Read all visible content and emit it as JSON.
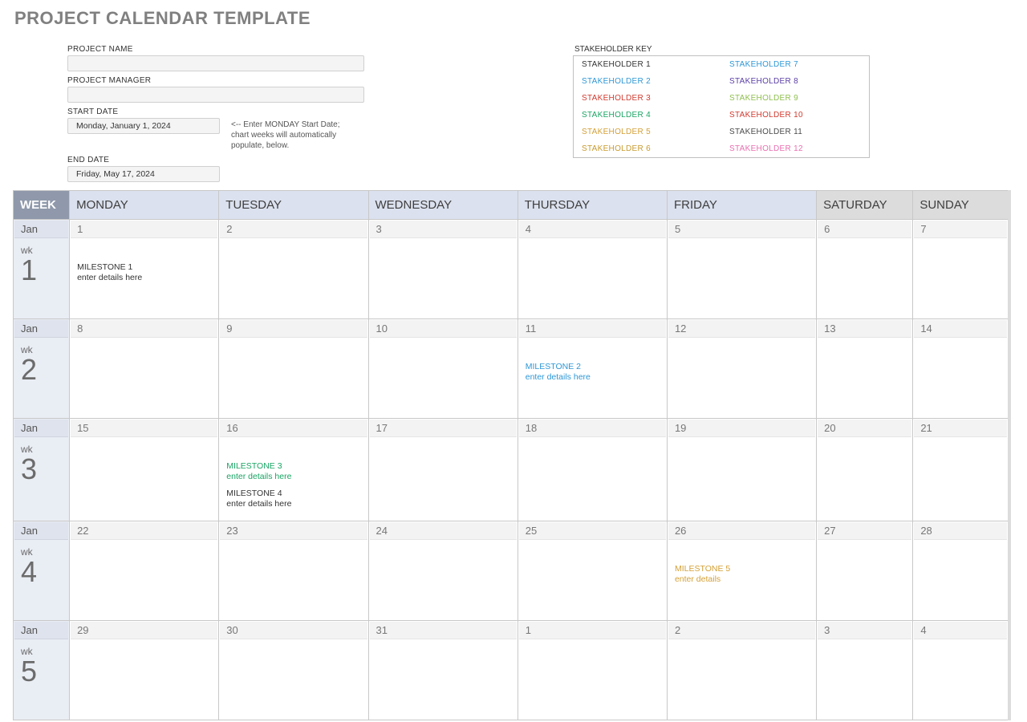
{
  "title": "PROJECT CALENDAR TEMPLATE",
  "labels": {
    "project_name": "PROJECT NAME",
    "project_manager": "PROJECT MANAGER",
    "start_date": "START DATE",
    "end_date": "END DATE",
    "stakeholder_key": "STAKEHOLDER KEY",
    "start_note": "<-- Enter MONDAY Start Date; chart weeks will automatically populate, below.",
    "week": "WEEK",
    "wk": "wk"
  },
  "fields": {
    "project_name": "",
    "project_manager": "",
    "start_date": "Monday, January 1, 2024",
    "end_date": "Friday, May 17, 2024"
  },
  "stakeholders": [
    {
      "label": "STAKEHOLDER 1",
      "color": "#333333"
    },
    {
      "label": "STAKEHOLDER 2",
      "color": "#2e97d6"
    },
    {
      "label": "STAKEHOLDER 3",
      "color": "#d13a2f"
    },
    {
      "label": "STAKEHOLDER 4",
      "color": "#1aa564"
    },
    {
      "label": "STAKEHOLDER 5",
      "color": "#d4a037"
    },
    {
      "label": "STAKEHOLDER 6",
      "color": "#c89b2e"
    },
    {
      "label": "STAKEHOLDER 7",
      "color": "#2e97d6"
    },
    {
      "label": "STAKEHOLDER 8",
      "color": "#5a3ea6"
    },
    {
      "label": "STAKEHOLDER 9",
      "color": "#8fbf4f"
    },
    {
      "label": "STAKEHOLDER 10",
      "color": "#d13a2f"
    },
    {
      "label": "STAKEHOLDER 11",
      "color": "#4a4a4a"
    },
    {
      "label": "STAKEHOLDER 12",
      "color": "#e86fb0"
    }
  ],
  "day_headers": [
    "MONDAY",
    "TUESDAY",
    "WEDNESDAY",
    "THURSDAY",
    "FRIDAY",
    "SATURDAY",
    "SUNDAY"
  ],
  "weeks": [
    {
      "month": "Jan",
      "num": "1",
      "days": [
        "1",
        "2",
        "3",
        "4",
        "5",
        "6",
        "7"
      ],
      "events": [
        [
          {
            "t1": "MILESTONE 1",
            "t2": "enter details here",
            "color": "#333333"
          }
        ],
        [],
        [],
        [],
        [],
        [],
        []
      ]
    },
    {
      "month": "Jan",
      "num": "2",
      "days": [
        "8",
        "9",
        "10",
        "11",
        "12",
        "13",
        "14"
      ],
      "events": [
        [],
        [],
        [],
        [
          {
            "t1": "MILESTONE 2",
            "t2": "enter details here",
            "color": "#2e97d6"
          }
        ],
        [],
        [],
        []
      ]
    },
    {
      "month": "Jan",
      "num": "3",
      "days": [
        "15",
        "16",
        "17",
        "18",
        "19",
        "20",
        "21"
      ],
      "events": [
        [],
        [
          {
            "t1": "MILESTONE 3",
            "t2": "enter details here",
            "color": "#1aa564"
          },
          {
            "t1": "MILESTONE 4",
            "t2": "enter details here",
            "color": "#333333"
          }
        ],
        [],
        [],
        [],
        [],
        []
      ]
    },
    {
      "month": "Jan",
      "num": "4",
      "days": [
        "22",
        "23",
        "24",
        "25",
        "26",
        "27",
        "28"
      ],
      "events": [
        [],
        [],
        [],
        [],
        [
          {
            "t1": "MILESTONE 5",
            "t2": "enter details",
            "color": "#d4a037"
          }
        ],
        [],
        []
      ]
    },
    {
      "month": "Jan",
      "num": "5",
      "days": [
        "29",
        "30",
        "31",
        "1",
        "2",
        "3",
        "4"
      ],
      "events": [
        [],
        [],
        [],
        [],
        [],
        [],
        []
      ]
    }
  ]
}
